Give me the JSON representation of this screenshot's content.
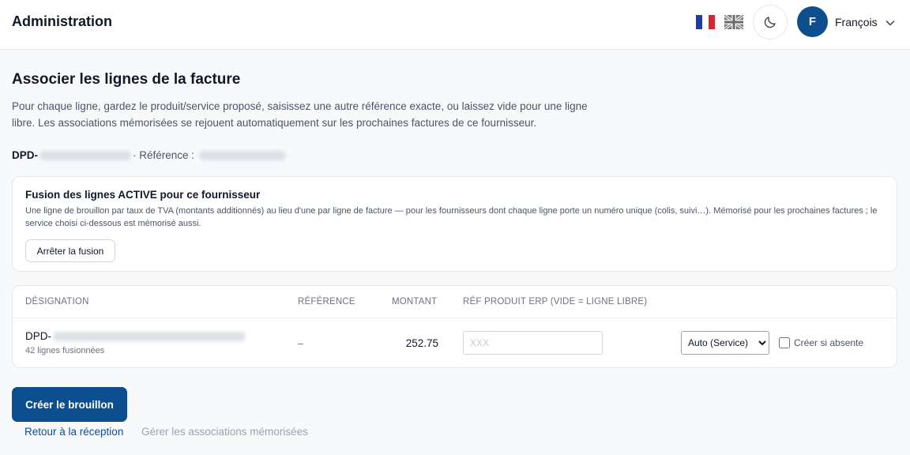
{
  "header": {
    "title": "Administration",
    "languages": [
      {
        "code": "fr",
        "icon": "flag-fr-icon"
      },
      {
        "code": "en",
        "icon": "flag-uk-icon"
      }
    ],
    "theme_icon": "moon-icon",
    "user": {
      "initial": "F",
      "name": "François",
      "menu_icon": "chevron-down-icon"
    }
  },
  "main": {
    "title": "Associer les lignes de la facture",
    "description": "Pour chaque ligne, gardez le produit/service proposé, saisissez une autre référence exacte, ou laissez vide pour une ligne libre. Les associations mémorisées se rejouent automatiquement sur les prochaines factures de ce fournisseur.",
    "supplier_prefix": "DPD-",
    "reference_label": "· Référence :"
  },
  "fusion": {
    "title": "Fusion des lignes ACTIVE pour ce fournisseur",
    "description": "Une ligne de brouillon par taux de TVA (montants additionnés) au lieu d'une par ligne de facture — pour les fournisseurs dont chaque ligne porte un numéro unique (colis, suivi…). Mémorisé pour les prochaines factures ; le service choisi ci-dessous est mémorisé aussi.",
    "stop_button": "Arrêter la fusion"
  },
  "table": {
    "headers": {
      "designation": "DÉSIGNATION",
      "reference": "RÉFÉRENCE",
      "amount": "MONTANT",
      "erp_ref": "RÉF PRODUIT ERP (VIDE = LIGNE LIBRE)"
    },
    "rows": [
      {
        "designation_prefix": "DPD-",
        "subtitle": "42 lignes fusionnées",
        "reference": "–",
        "amount": "252.75",
        "erp_placeholder": "XXX",
        "service_options": [
          "Auto (Service)"
        ],
        "service_selected": "Auto (Service)",
        "create_label": "Créer si absente",
        "create_checked": false
      }
    ]
  },
  "actions": {
    "create_draft": "Créer le brouillon",
    "back_link": "Retour à la réception",
    "manage_link": "Gérer les associations mémorisées"
  },
  "colors": {
    "primary": "#0d4e8f",
    "background": "#f8f9fb",
    "card": "#ffffff",
    "muted_link": "#9ca3af"
  }
}
